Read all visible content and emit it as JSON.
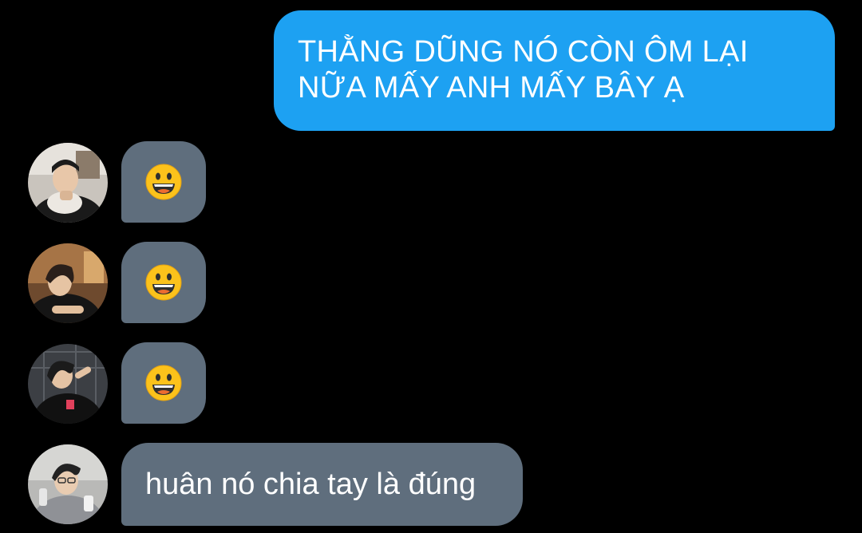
{
  "conversation": {
    "outgoing": {
      "line1": "THẰNG DŨNG NÓ CÒN ÔM LẠI",
      "line2": "NỮA MẤY ANH MẤY BÂY Ạ"
    },
    "incoming": [
      {
        "avatar": "user-photo-avatar",
        "emoji_icon": "grinning-face-icon"
      },
      {
        "avatar": "user-photo-avatar",
        "emoji_icon": "grinning-face-icon"
      },
      {
        "avatar": "user-photo-avatar",
        "emoji_icon": "grinning-face-icon"
      },
      {
        "avatar": "user-photo-avatar",
        "text": "huân nó chia tay là đúng"
      }
    ]
  },
  "colors": {
    "background": "#000000",
    "outgoing_bubble": "#1da1f2",
    "incoming_bubble": "#5f6e7d",
    "text": "#ffffff"
  }
}
